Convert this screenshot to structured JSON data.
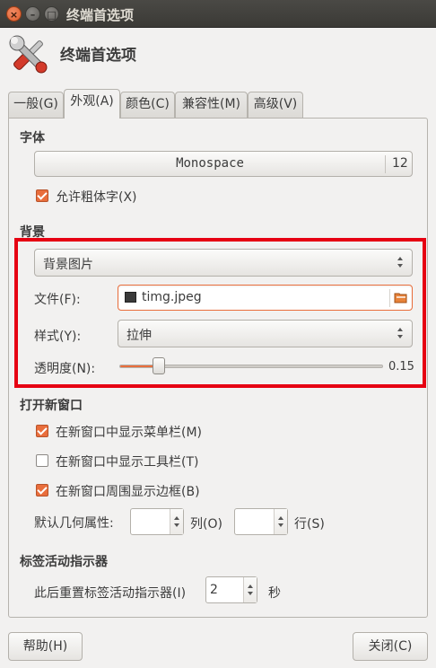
{
  "window": {
    "title": "终端首选项",
    "close_glyph": "×",
    "min_glyph": "–",
    "max_glyph": "□"
  },
  "header": {
    "title": "终端首选项",
    "icon": "preferences-tools-icon"
  },
  "tabs": [
    {
      "label": "一般(G)"
    },
    {
      "label": "外观(A)"
    },
    {
      "label": "颜色(C)"
    },
    {
      "label": "兼容性(M)"
    },
    {
      "label": "高级(V)"
    }
  ],
  "font_section": {
    "title": "字体",
    "font_name": "Monospace",
    "font_size": "12",
    "allow_bold_label": "允许粗体字(X)",
    "allow_bold_checked": true
  },
  "background_section": {
    "title": "背景",
    "type_value": "背景图片",
    "file_label": "文件(F):",
    "file_value": "timg.jpeg",
    "style_label": "样式(Y):",
    "style_value": "拉伸",
    "transparency_label": "透明度(N):",
    "transparency_value": "0.15",
    "transparency_fraction": 0.15
  },
  "new_window_section": {
    "title": "打开新窗口",
    "show_menubar_label": "在新窗口中显示菜单栏(M)",
    "show_menubar_checked": true,
    "show_toolbar_label": "在新窗口中显示工具栏(T)",
    "show_toolbar_checked": false,
    "show_border_label": "在新窗口周围显示边框(B)",
    "show_border_checked": true,
    "geometry_label": "默认几何属性:",
    "cols_value": "",
    "cols_label": "列(O)",
    "rows_value": "",
    "rows_label": "行(S)"
  },
  "tab_indicator_section": {
    "title": "标签活动指示器",
    "reset_label": "此后重置标签活动指示器(I)",
    "reset_value": "2",
    "unit_label": "秒"
  },
  "footer": {
    "help_label": "帮助(H)",
    "close_label": "关闭(C)"
  },
  "colors": {
    "accent": "#e96e3c",
    "highlight_box": "#e60012",
    "titlebar": "#3b3a36"
  }
}
